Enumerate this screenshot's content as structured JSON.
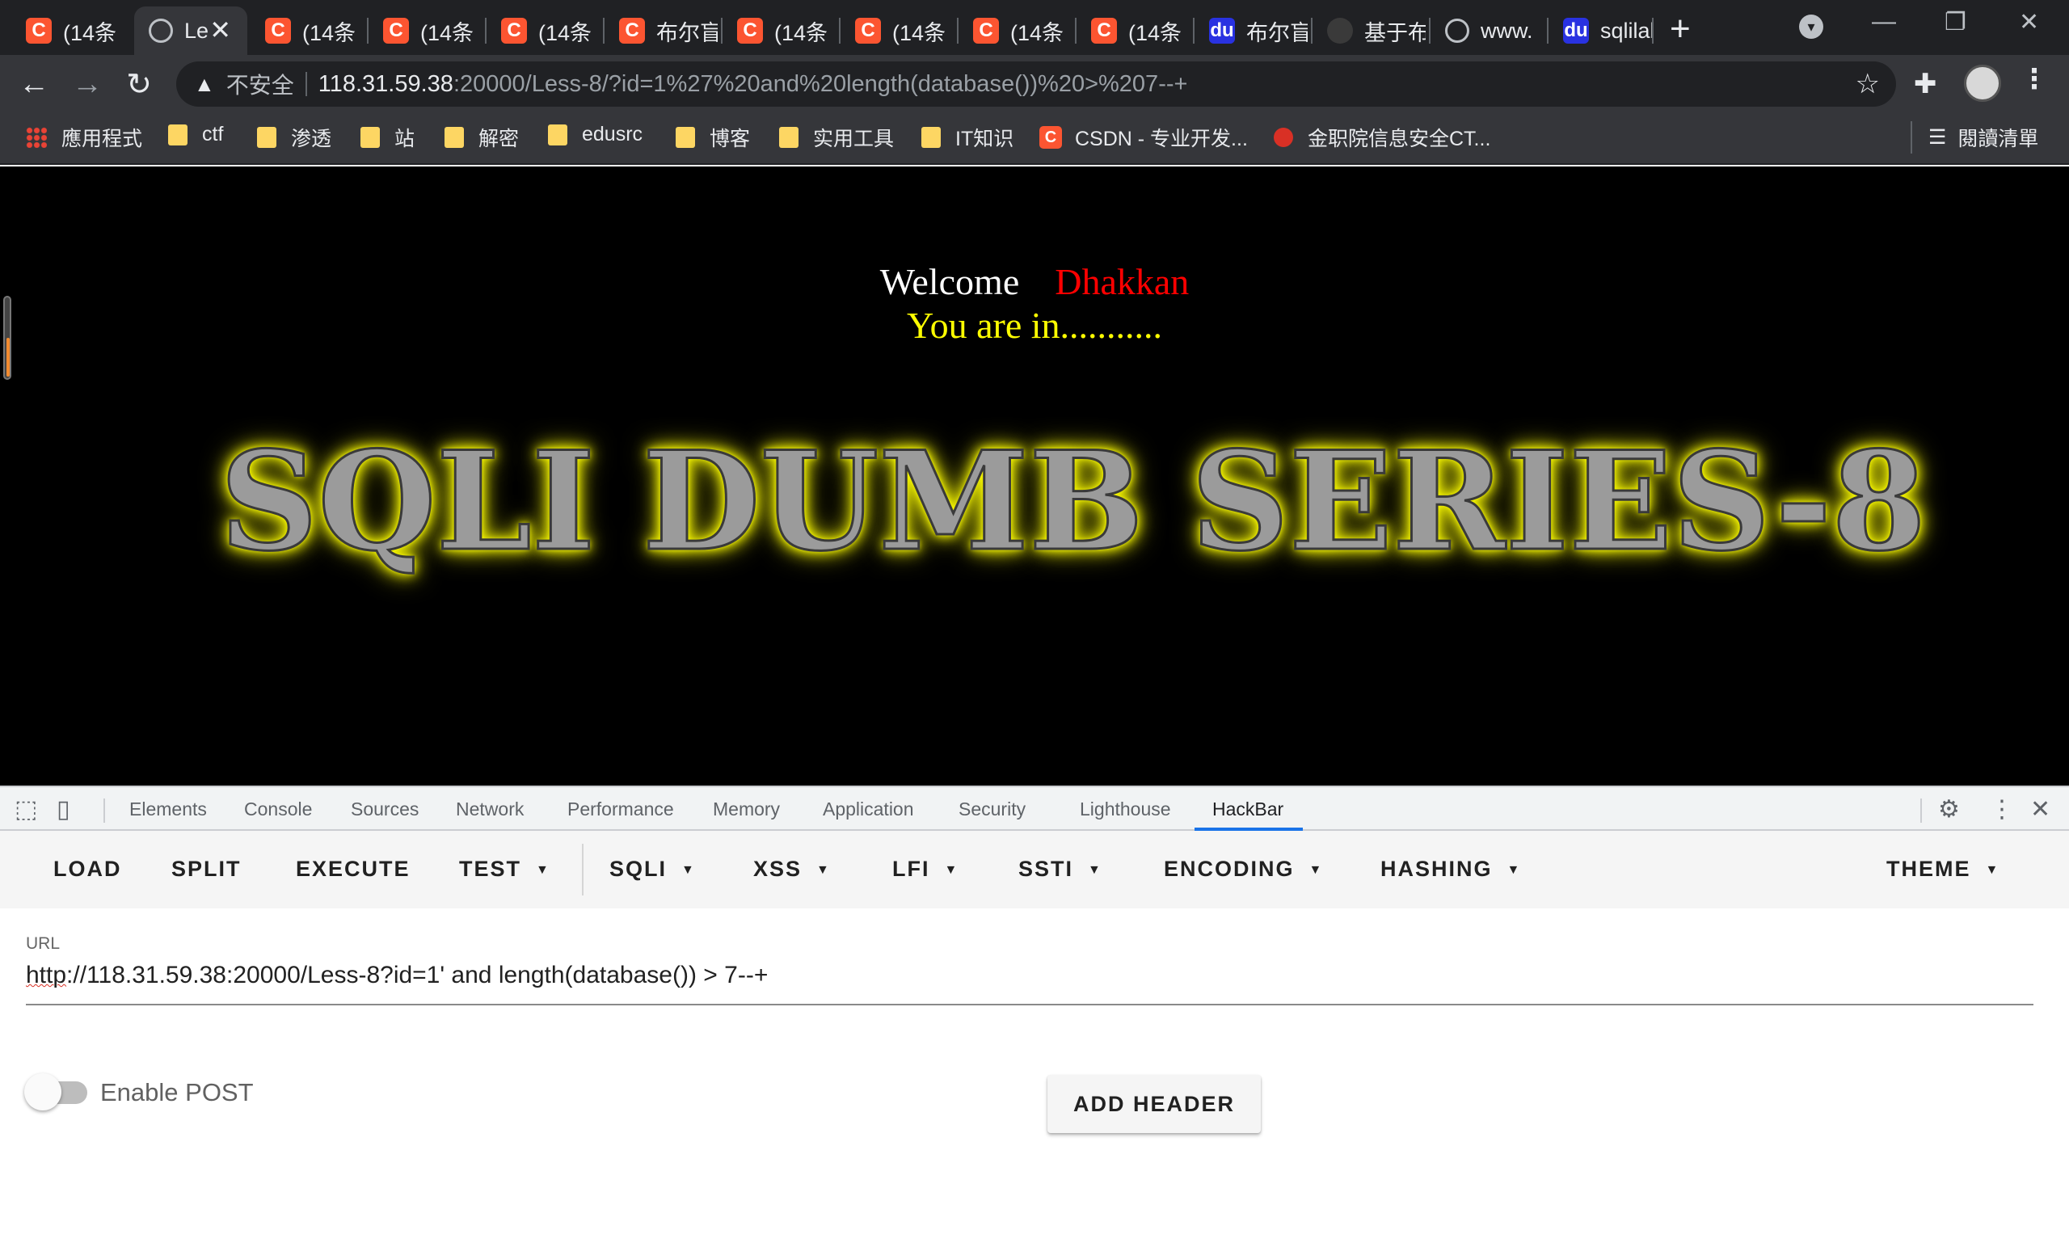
{
  "tabs": [
    {
      "title": "(14条",
      "icon": "csdn-c-icon"
    },
    {
      "title": "Le",
      "icon": "globe-icon",
      "active": true
    },
    {
      "title": "(14条",
      "icon": "csdn-c-icon"
    },
    {
      "title": "(14条",
      "icon": "csdn-c-icon"
    },
    {
      "title": "(14条",
      "icon": "csdn-c-icon"
    },
    {
      "title": "布尔盲",
      "icon": "csdn-c-icon"
    },
    {
      "title": "(14条",
      "icon": "csdn-c-icon"
    },
    {
      "title": "(14条",
      "icon": "csdn-c-icon"
    },
    {
      "title": "(14条",
      "icon": "csdn-c-icon"
    },
    {
      "title": "(14条",
      "icon": "csdn-c-icon"
    },
    {
      "title": "布尔盲",
      "icon": "baidu-icon"
    },
    {
      "title": "基于布",
      "icon": "dark-site-icon"
    },
    {
      "title": "www.",
      "icon": "globe-icon"
    },
    {
      "title": "sqlilal",
      "icon": "baidu-icon"
    }
  ],
  "tab_close": "✕",
  "new_tab": "+",
  "window": {
    "minimize": "—",
    "restore": "❐",
    "close": "✕"
  },
  "address": {
    "security_label": "不安全",
    "url_host": "118.31.59.38",
    "url_rest": ":20000/Less-8/?id=1%27%20and%20length(database())%20>%207--+"
  },
  "bookmarks": [
    {
      "label": "應用程式",
      "icon": "apps-icon"
    },
    {
      "label": "ctf",
      "icon": "folder-icon"
    },
    {
      "label": "渗透",
      "icon": "folder-icon"
    },
    {
      "label": "站",
      "icon": "folder-icon"
    },
    {
      "label": "解密",
      "icon": "folder-icon"
    },
    {
      "label": "edusrc",
      "icon": "folder-icon"
    },
    {
      "label": "博客",
      "icon": "folder-icon"
    },
    {
      "label": "实用工具",
      "icon": "folder-icon"
    },
    {
      "label": "IT知识",
      "icon": "folder-icon"
    },
    {
      "label": "CSDN - 专业开发...",
      "icon": "csdn-c-icon"
    },
    {
      "label": "金职院信息安全CT...",
      "icon": "red-site-icon"
    }
  ],
  "reading_list": "閱讀清單",
  "page": {
    "welcome": "Welcome",
    "user": "Dhakkan",
    "status": "You are in...........",
    "banner": "SQLI DUMB SERIES-8"
  },
  "devtools": {
    "tabs": [
      "Elements",
      "Console",
      "Sources",
      "Network",
      "Performance",
      "Memory",
      "Application",
      "Security",
      "Lighthouse",
      "HackBar"
    ],
    "active_tab": "HackBar"
  },
  "hackbar": {
    "menu": [
      "LOAD",
      "SPLIT",
      "EXECUTE",
      "TEST",
      "SQLI",
      "XSS",
      "LFI",
      "SSTI",
      "ENCODING",
      "HASHING",
      "THEME"
    ],
    "url_label": "URL",
    "url_scheme": "http",
    "url_value": "://118.31.59.38:20000/Less-8?id=1' and length(database()) > 7--+",
    "enable_post_label": "Enable POST",
    "enable_post": false,
    "add_header_label": "ADD HEADER"
  },
  "colors": {
    "welcome": "#ffffff",
    "user": "#ff0000",
    "status": "#ffff00",
    "banner_glow": "#ffff00",
    "active_tab_underline": "#1a73e8",
    "csdn": "#fc5531"
  }
}
